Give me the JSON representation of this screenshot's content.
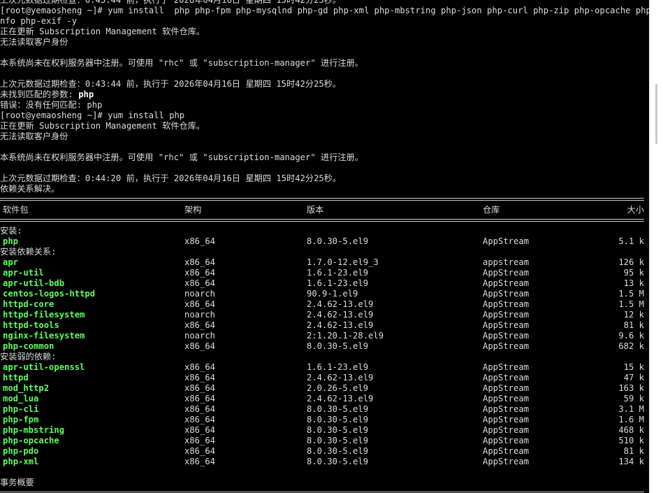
{
  "terminal": {
    "lines_top": [
      {
        "text": "上次元数据过期检查：0:43:44 前，执行于 2026年04月16日 星期四 15时42分25秒。"
      },
      {
        "text": "[root@yemaosheng ~]# yum install  php php-fpm php-mysqlnd php-gd php-xml php-mbstring php-json php-curl php-zip php-opcache php-filei"
      },
      {
        "text": "nfo php-exif -y"
      },
      {
        "text": "正在更新 Subscription Management 软件仓库。"
      },
      {
        "text": "无法读取客户身份"
      },
      {
        "text": ""
      },
      {
        "text": "本系统尚未在权利服务器中注册。可使用 \"rhc\" 或 \"subscription-manager\" 进行注册。"
      },
      {
        "text": ""
      },
      {
        "text": "上次元数据过期检查：0:43:44 前，执行于 2026年04月16日 星期四 15时42分25秒。"
      }
    ],
    "no_match_label": "未找到匹配的参数: ",
    "no_match_value": "php",
    "lines_mid": [
      {
        "text": "错误：没有任何匹配: php"
      },
      {
        "text": "[root@yemaosheng ~]# yum install php"
      },
      {
        "text": "正在更新 Subscription Management 软件仓库。"
      },
      {
        "text": "无法读取客户身份"
      },
      {
        "text": ""
      },
      {
        "text": "本系统尚未在权利服务器中注册。可使用 \"rhc\" 或 \"subscription-manager\" 进行注册。"
      },
      {
        "text": ""
      },
      {
        "text": "上次元数据过期检查：0:44:20 前，执行于 2026年04月16日 星期四 15时42分25秒。"
      },
      {
        "text": "依赖关系解决。"
      }
    ],
    "table_header": {
      "name": "软件包",
      "arch": "架构",
      "version": "版本",
      "repo": "仓库",
      "size": "大小"
    },
    "sections": [
      {
        "title": "安装:",
        "packages": [
          {
            "name": "php",
            "arch": "x86_64",
            "version": "8.0.30-5.el9",
            "repo": "AppStream",
            "size": "5.1 k"
          }
        ]
      },
      {
        "title": "安装依赖关系:",
        "packages": [
          {
            "name": "apr",
            "arch": "x86_64",
            "version": "1.7.0-12.el9_3",
            "repo": "appstream",
            "size": "126 k"
          },
          {
            "name": "apr-util",
            "arch": "x86_64",
            "version": "1.6.1-23.el9",
            "repo": "AppStream",
            "size": "95 k"
          },
          {
            "name": "apr-util-bdb",
            "arch": "x86_64",
            "version": "1.6.1-23.el9",
            "repo": "AppStream",
            "size": "13 k"
          },
          {
            "name": "centos-logos-httpd",
            "arch": "noarch",
            "version": "90.9-1.el9",
            "repo": "AppStream",
            "size": "1.5 M"
          },
          {
            "name": "httpd-core",
            "arch": "x86_64",
            "version": "2.4.62-13.el9",
            "repo": "AppStream",
            "size": "1.5 M"
          },
          {
            "name": "httpd-filesystem",
            "arch": "noarch",
            "version": "2.4.62-13.el9",
            "repo": "AppStream",
            "size": "12 k"
          },
          {
            "name": "httpd-tools",
            "arch": "x86_64",
            "version": "2.4.62-13.el9",
            "repo": "AppStream",
            "size": "81 k"
          },
          {
            "name": "nginx-filesystem",
            "arch": "noarch",
            "version": "2:1.20.1-28.el9",
            "repo": "AppStream",
            "size": "9.6 k"
          },
          {
            "name": "php-common",
            "arch": "x86_64",
            "version": "8.0.30-5.el9",
            "repo": "AppStream",
            "size": "682 k"
          }
        ]
      },
      {
        "title": "安装弱的依赖:",
        "packages": [
          {
            "name": "apr-util-openssl",
            "arch": "x86_64",
            "version": "1.6.1-23.el9",
            "repo": "AppStream",
            "size": "15 k"
          },
          {
            "name": "httpd",
            "arch": "x86_64",
            "version": "2.4.62-13.el9",
            "repo": "AppStream",
            "size": "47 k"
          },
          {
            "name": "mod_http2",
            "arch": "x86_64",
            "version": "2.0.26-5.el9",
            "repo": "AppStream",
            "size": "163 k"
          },
          {
            "name": "mod_lua",
            "arch": "x86_64",
            "version": "2.4.62-13.el9",
            "repo": "AppStream",
            "size": "59 k"
          },
          {
            "name": "php-cli",
            "arch": "x86_64",
            "version": "8.0.30-5.el9",
            "repo": "AppStream",
            "size": "3.1 M"
          },
          {
            "name": "php-fpm",
            "arch": "x86_64",
            "version": "8.0.30-5.el9",
            "repo": "AppStream",
            "size": "1.6 M"
          },
          {
            "name": "php-mbstring",
            "arch": "x86_64",
            "version": "8.0.30-5.el9",
            "repo": "AppStream",
            "size": "468 k"
          },
          {
            "name": "php-opcache",
            "arch": "x86_64",
            "version": "8.0.30-5.el9",
            "repo": "AppStream",
            "size": "510 k"
          },
          {
            "name": "php-pdo",
            "arch": "x86_64",
            "version": "8.0.30-5.el9",
            "repo": "AppStream",
            "size": "81 k"
          },
          {
            "name": "php-xml",
            "arch": "x86_64",
            "version": "8.0.30-5.el9",
            "repo": "AppStream",
            "size": "134 k"
          }
        ]
      }
    ],
    "summary_title": "事务概要"
  }
}
